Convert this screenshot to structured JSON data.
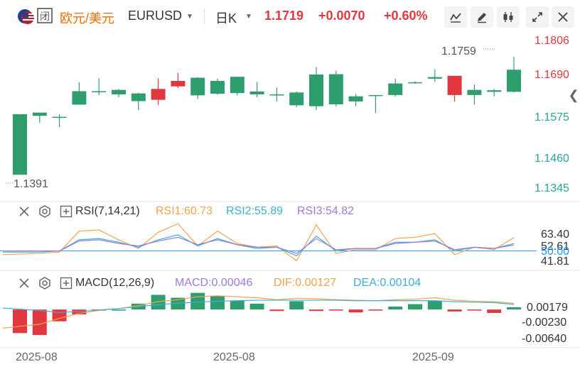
{
  "header": {
    "pair_label": "欧元/美元",
    "symbol": "EURUSD",
    "period": "日K",
    "price": "1.1719",
    "change": "+0.0070",
    "change_pct": "+0.60%",
    "icons": [
      "line-draw-icon",
      "pencil-icon",
      "candle-type-icon",
      "fullscreen-icon",
      "close-icon"
    ]
  },
  "main_chart": {
    "y_ticks": [
      "1.1806",
      "1.1690",
      "1.1575",
      "1.1460",
      "1.1345"
    ],
    "high_label": "1.1759",
    "low_label": "1.1391"
  },
  "rsi": {
    "title": "RSI(7,14,21)",
    "rsi1_label": "RSI1:60.73",
    "rsi2_label": "RSI2:55.89",
    "rsi3_label": "RSI3:54.82",
    "y_ticks": [
      "63.40",
      "52.61",
      "50.00",
      "41.81"
    ]
  },
  "macd": {
    "title": "MACD(12,26,9)",
    "macd_label": "MACD:0.00046",
    "dif_label": "DIF:0.00127",
    "dea_label": "DEA:0.00104",
    "y_ticks": [
      "0.00179",
      "-0.00230",
      "-0.00640"
    ]
  },
  "x_axis": [
    "2025-08",
    "2025-08",
    "2025-09"
  ],
  "colors": {
    "up": "#e0383e",
    "down": "#26a69a",
    "down_fill": "#2e9e6e",
    "rsi1": "#f4a34c",
    "rsi2": "#3ab0d8",
    "rsi3": "#9c7bd8",
    "dif": "#f4a34c",
    "dea": "#3ab0d8",
    "ref": "#2196f3"
  },
  "chart_data": [
    {
      "type": "candlestick",
      "ylim": [
        1.1345,
        1.1806
      ],
      "candles": [
        {
          "o": 1.1391,
          "h": 1.158,
          "l": 1.1391,
          "c": 1.158
        },
        {
          "o": 1.1575,
          "h": 1.1585,
          "l": 1.1553,
          "c": 1.1585
        },
        {
          "o": 1.1571,
          "h": 1.158,
          "l": 1.154,
          "c": 1.1572
        },
        {
          "o": 1.161,
          "h": 1.168,
          "l": 1.161,
          "c": 1.1652
        },
        {
          "o": 1.1652,
          "h": 1.1692,
          "l": 1.164,
          "c": 1.1652
        },
        {
          "o": 1.1642,
          "h": 1.1659,
          "l": 1.1633,
          "c": 1.1656
        },
        {
          "o": 1.1621,
          "h": 1.1647,
          "l": 1.1593,
          "c": 1.1645
        },
        {
          "o": 1.1659,
          "h": 1.1692,
          "l": 1.1609,
          "c": 1.1625
        },
        {
          "o": 1.1684,
          "h": 1.1709,
          "l": 1.1662,
          "c": 1.1667
        },
        {
          "o": 1.1639,
          "h": 1.1696,
          "l": 1.1628,
          "c": 1.1694
        },
        {
          "o": 1.1644,
          "h": 1.1691,
          "l": 1.1641,
          "c": 1.1684
        },
        {
          "o": 1.1646,
          "h": 1.1697,
          "l": 1.1639,
          "c": 1.1697
        },
        {
          "o": 1.1642,
          "h": 1.1681,
          "l": 1.1633,
          "c": 1.1651
        },
        {
          "o": 1.164,
          "h": 1.1663,
          "l": 1.162,
          "c": 1.1642
        },
        {
          "o": 1.1608,
          "h": 1.1651,
          "l": 1.1602,
          "c": 1.1648
        },
        {
          "o": 1.1605,
          "h": 1.1727,
          "l": 1.1593,
          "c": 1.1704
        },
        {
          "o": 1.1611,
          "h": 1.1716,
          "l": 1.1604,
          "c": 1.1705
        },
        {
          "o": 1.162,
          "h": 1.1644,
          "l": 1.1605,
          "c": 1.1636
        },
        {
          "o": 1.164,
          "h": 1.164,
          "l": 1.1584,
          "c": 1.164
        },
        {
          "o": 1.164,
          "h": 1.1691,
          "l": 1.1635,
          "c": 1.1676
        },
        {
          "o": 1.168,
          "h": 1.1683,
          "l": 1.1675,
          "c": 1.168
        },
        {
          "o": 1.1691,
          "h": 1.172,
          "l": 1.1681,
          "c": 1.1696
        },
        {
          "o": 1.17,
          "h": 1.17,
          "l": 1.162,
          "c": 1.164
        },
        {
          "o": 1.164,
          "h": 1.1673,
          "l": 1.161,
          "c": 1.1656
        },
        {
          "o": 1.165,
          "h": 1.1659,
          "l": 1.1635,
          "c": 1.1655
        },
        {
          "o": 1.165,
          "h": 1.1759,
          "l": 1.1648,
          "c": 1.1719
        }
      ]
    },
    {
      "type": "line",
      "name_ref": "RSI(7,14,21)",
      "ylim": [
        36,
        75
      ],
      "ref_line": 50,
      "series": [
        {
          "name": "RSI1",
          "values": [
            47,
            48,
            49,
            66,
            67,
            59,
            52,
            65,
            72,
            54,
            66,
            56,
            53,
            54,
            42,
            71,
            48,
            51,
            51,
            60,
            61,
            64,
            47,
            53,
            51,
            60.73
          ]
        },
        {
          "name": "RSI2",
          "values": [
            49,
            49,
            50,
            59,
            60,
            57,
            53,
            59,
            63,
            54,
            60,
            55,
            52,
            53,
            46,
            62,
            50,
            52,
            52,
            57,
            57,
            59,
            50,
            53,
            52,
            55.89
          ]
        },
        {
          "name": "RSI3",
          "values": [
            50,
            50,
            50,
            58,
            59,
            56,
            54,
            58,
            61,
            55,
            59,
            55,
            53,
            53,
            48,
            60,
            51,
            52,
            52,
            56,
            57,
            58,
            51,
            53,
            52,
            54.82
          ]
        }
      ]
    },
    {
      "type": "bar",
      "name_ref": "MACD(12,26,9)",
      "ylim": [
        -0.0075,
        0.0035
      ],
      "macd": [
        -0.0048,
        -0.0052,
        -0.0024,
        -0.001,
        -0.0002,
        0.0,
        0.0012,
        0.003,
        0.0024,
        0.0034,
        0.0028,
        0.0018,
        0.0012,
        -0.0003,
        0.0017,
        -0.0003,
        -0.0002,
        -0.0006,
        -0.0002,
        0.0006,
        0.0011,
        0.0018,
        -0.0004,
        -0.0002,
        -0.0007,
        0.00046
      ],
      "dif": [
        -0.0038,
        -0.003,
        -0.0018,
        -0.0008,
        -0.0002,
        0.0002,
        0.0008,
        0.0016,
        0.002,
        0.0026,
        0.0028,
        0.0026,
        0.0024,
        0.002,
        0.0023,
        0.0022,
        0.002,
        0.0019,
        0.0018,
        0.002,
        0.0021,
        0.0024,
        0.0019,
        0.0017,
        0.0016,
        0.00127
      ],
      "dea": [
        0.0003,
        -0.0002,
        -0.0006,
        -0.0004,
        -0.0001,
        0.0002,
        0.0006,
        0.001,
        0.0013,
        0.0015,
        0.0017,
        0.0018,
        0.0019,
        0.0019,
        0.0019,
        0.0019,
        0.0019,
        0.0018,
        0.0018,
        0.0018,
        0.0018,
        0.0018,
        0.0016,
        0.0015,
        0.0014,
        0.00104
      ]
    }
  ]
}
